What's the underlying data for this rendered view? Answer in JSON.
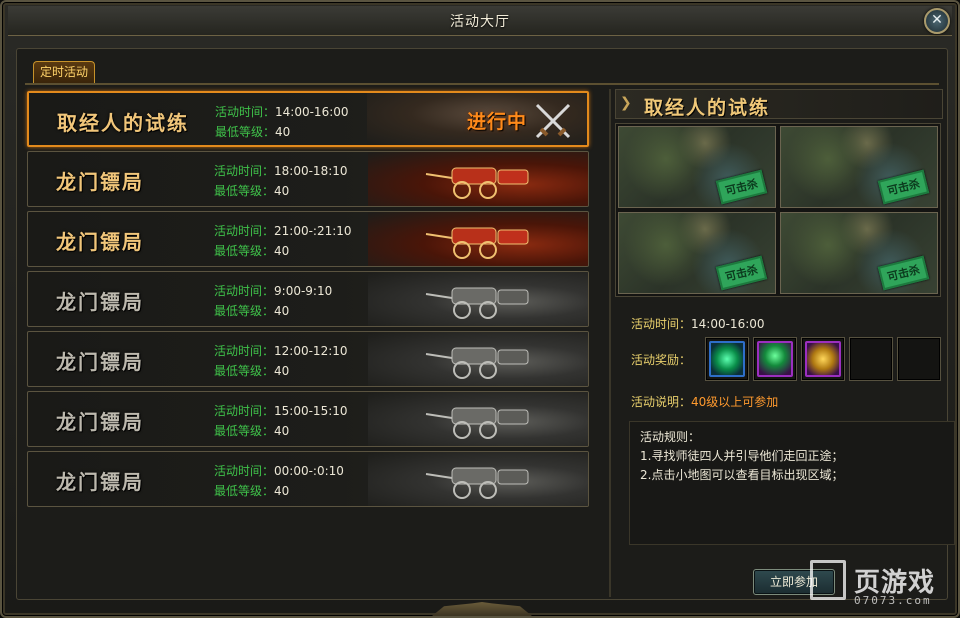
{
  "window": {
    "title": "活动大厅",
    "close_label": "✕"
  },
  "tabs": [
    {
      "label": "定时活动"
    }
  ],
  "labels": {
    "time": "活动时间：",
    "level": "最低等级："
  },
  "activities": [
    {
      "name": "取经人的试练",
      "time": "14:00-16:00",
      "level": "40",
      "status": "进行中",
      "style": "selected"
    },
    {
      "name": "龙门镖局",
      "time": "18:00-18:10",
      "level": "40",
      "style": "gold"
    },
    {
      "name": "龙门镖局",
      "time": "21:00-:21:10",
      "level": "40",
      "style": "gold"
    },
    {
      "name": "龙门镖局",
      "time": "9:00-9:10",
      "level": "40",
      "style": "dim"
    },
    {
      "name": "龙门镖局",
      "time": "12:00-12:10",
      "level": "40",
      "style": "dim"
    },
    {
      "name": "龙门镖局",
      "time": "15:00-15:10",
      "level": "40",
      "style": "dim"
    },
    {
      "name": "龙门镖局",
      "time": "00:00-:0:10",
      "level": "40",
      "style": "dim"
    }
  ],
  "detail": {
    "title": "取经人的试练",
    "map_stamp": "可击杀",
    "time_label": "活动时间：",
    "time_value": "14:00-16:00",
    "reward_label": "活动奖励：",
    "desc_label": "活动说明：",
    "desc_value": "40级以上可参加",
    "rules_label": "活动规则：",
    "rules": [
      "1.寻找师徒四人并引导他们走回正途；",
      "2.点击小地图可以查看目标出现区域；"
    ],
    "join_label": "立即参加"
  },
  "watermark": {
    "text": "页游戏",
    "url": "07073.com"
  },
  "colors": {
    "accent": "#e38a1c",
    "label_green": "#3fc24a",
    "label_yellow": "#e8cf6c",
    "status_orange": "#ff8a1a"
  }
}
